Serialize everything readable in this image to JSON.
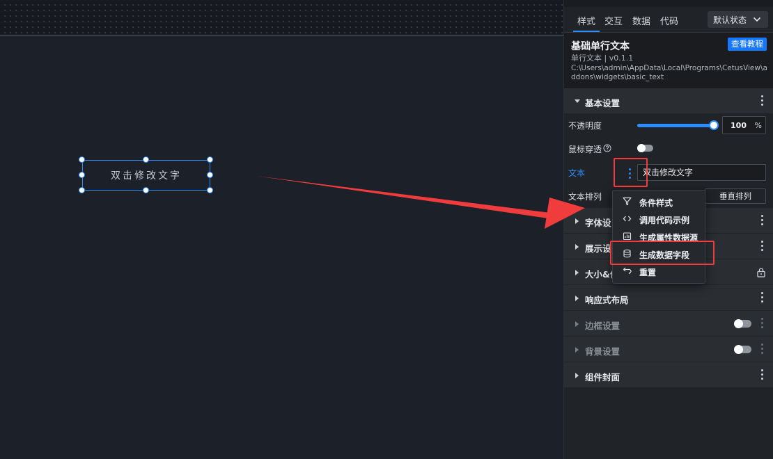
{
  "canvas": {
    "widget_text": "双击修改文字"
  },
  "panel": {
    "tabs": [
      {
        "label": "样式"
      },
      {
        "label": "交互"
      },
      {
        "label": "数据"
      },
      {
        "label": "代码"
      }
    ],
    "state_select": "默认状态",
    "widget": {
      "title": "基础单行文本",
      "version": "单行文本 | v0.1.1",
      "path": "C:\\Users\\admin\\AppData\\Local\\Programs\\CetusView\\addons\\widgets\\basic_text",
      "tutorial_button": "查看教程"
    },
    "basic_settings": {
      "title": "基本设置",
      "opacity_label": "不透明度",
      "opacity_value": "100",
      "opacity_percent": 1.0,
      "opacity_unit": "%",
      "mouse_through_label": "鼠标穿透",
      "text_label": "文本",
      "text_value": "双击修改文字",
      "text_arrange_label": "文本排列",
      "vertical_button": "垂直排列"
    },
    "sections": [
      {
        "title": "字体设"
      },
      {
        "title": "展示设"
      },
      {
        "title": "大小&位"
      },
      {
        "title": "响应式布局"
      },
      {
        "title": "边框设置"
      },
      {
        "title": "背景设置"
      },
      {
        "title": "组件封面"
      }
    ]
  },
  "context_menu": {
    "items": [
      {
        "label": "条件样式",
        "icon": "filter-icon"
      },
      {
        "label": "调用代码示例",
        "icon": "code-icon"
      },
      {
        "label": "生成属性数据源",
        "icon": "datasource-icon"
      },
      {
        "label": "生成数据字段",
        "icon": "database-icon"
      },
      {
        "label": "重置",
        "icon": "reset-icon"
      }
    ]
  },
  "colors": {
    "accent": "#2f8cff",
    "highlight": "#f03c3c",
    "panel_bg": "#202327",
    "canvas_bg": "#1b2029"
  }
}
